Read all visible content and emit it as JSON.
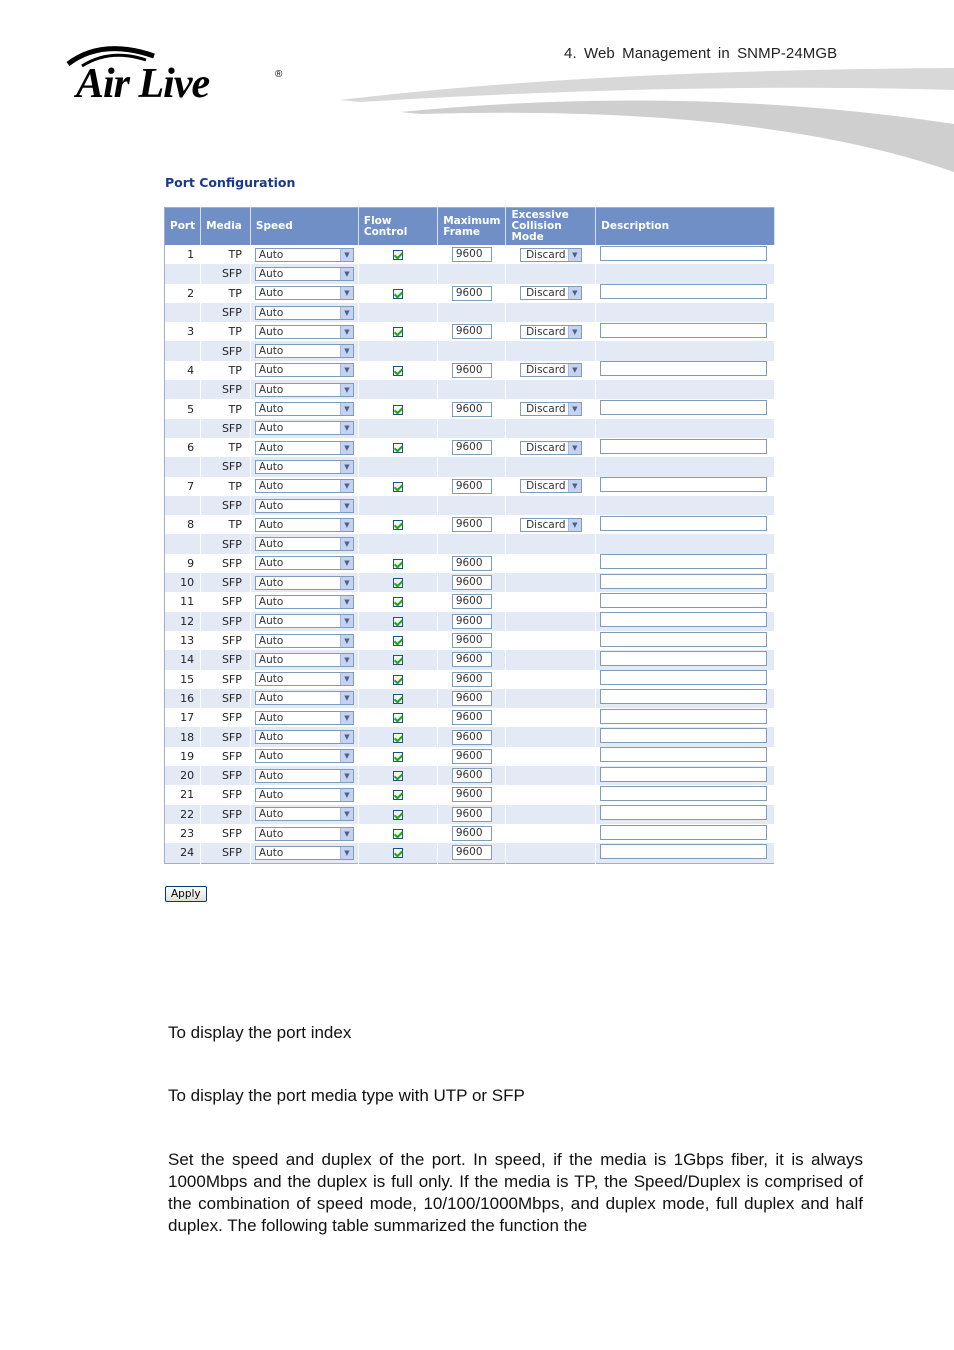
{
  "header": {
    "chapter_note": "4.  Web Management in SNMP-24MGB",
    "logo_text": "Air Live",
    "logo_mark": "®"
  },
  "panel": {
    "title": "Port Configuration",
    "columns": [
      "Port",
      "Media",
      "Speed",
      "Flow Control",
      "Maximum Frame",
      "Excessive Collision Mode",
      "Description"
    ],
    "apply_label": "Apply",
    "rows": [
      {
        "port": "1",
        "media": "TP",
        "speed": "Auto",
        "flow_control": true,
        "max_frame": "9600",
        "ecm": "Discard",
        "description": ""
      },
      {
        "port": "",
        "media": "SFP",
        "speed": "Auto",
        "flow_control": null,
        "max_frame": null,
        "ecm": null,
        "description": null
      },
      {
        "port": "2",
        "media": "TP",
        "speed": "Auto",
        "flow_control": true,
        "max_frame": "9600",
        "ecm": "Discard",
        "description": ""
      },
      {
        "port": "",
        "media": "SFP",
        "speed": "Auto",
        "flow_control": null,
        "max_frame": null,
        "ecm": null,
        "description": null
      },
      {
        "port": "3",
        "media": "TP",
        "speed": "Auto",
        "flow_control": true,
        "max_frame": "9600",
        "ecm": "Discard",
        "description": ""
      },
      {
        "port": "",
        "media": "SFP",
        "speed": "Auto",
        "flow_control": null,
        "max_frame": null,
        "ecm": null,
        "description": null
      },
      {
        "port": "4",
        "media": "TP",
        "speed": "Auto",
        "flow_control": true,
        "max_frame": "9600",
        "ecm": "Discard",
        "description": ""
      },
      {
        "port": "",
        "media": "SFP",
        "speed": "Auto",
        "flow_control": null,
        "max_frame": null,
        "ecm": null,
        "description": null
      },
      {
        "port": "5",
        "media": "TP",
        "speed": "Auto",
        "flow_control": true,
        "max_frame": "9600",
        "ecm": "Discard",
        "description": ""
      },
      {
        "port": "",
        "media": "SFP",
        "speed": "Auto",
        "flow_control": null,
        "max_frame": null,
        "ecm": null,
        "description": null
      },
      {
        "port": "6",
        "media": "TP",
        "speed": "Auto",
        "flow_control": true,
        "max_frame": "9600",
        "ecm": "Discard",
        "description": ""
      },
      {
        "port": "",
        "media": "SFP",
        "speed": "Auto",
        "flow_control": null,
        "max_frame": null,
        "ecm": null,
        "description": null
      },
      {
        "port": "7",
        "media": "TP",
        "speed": "Auto",
        "flow_control": true,
        "max_frame": "9600",
        "ecm": "Discard",
        "description": ""
      },
      {
        "port": "",
        "media": "SFP",
        "speed": "Auto",
        "flow_control": null,
        "max_frame": null,
        "ecm": null,
        "description": null
      },
      {
        "port": "8",
        "media": "TP",
        "speed": "Auto",
        "flow_control": true,
        "max_frame": "9600",
        "ecm": "Discard",
        "description": ""
      },
      {
        "port": "",
        "media": "SFP",
        "speed": "Auto",
        "flow_control": null,
        "max_frame": null,
        "ecm": null,
        "description": null
      },
      {
        "port": "9",
        "media": "SFP",
        "speed": "Auto",
        "flow_control": true,
        "max_frame": "9600",
        "ecm": null,
        "description": ""
      },
      {
        "port": "10",
        "media": "SFP",
        "speed": "Auto",
        "flow_control": true,
        "max_frame": "9600",
        "ecm": null,
        "description": ""
      },
      {
        "port": "11",
        "media": "SFP",
        "speed": "Auto",
        "flow_control": true,
        "max_frame": "9600",
        "ecm": null,
        "description": ""
      },
      {
        "port": "12",
        "media": "SFP",
        "speed": "Auto",
        "flow_control": true,
        "max_frame": "9600",
        "ecm": null,
        "description": ""
      },
      {
        "port": "13",
        "media": "SFP",
        "speed": "Auto",
        "flow_control": true,
        "max_frame": "9600",
        "ecm": null,
        "description": ""
      },
      {
        "port": "14",
        "media": "SFP",
        "speed": "Auto",
        "flow_control": true,
        "max_frame": "9600",
        "ecm": null,
        "description": ""
      },
      {
        "port": "15",
        "media": "SFP",
        "speed": "Auto",
        "flow_control": true,
        "max_frame": "9600",
        "ecm": null,
        "description": ""
      },
      {
        "port": "16",
        "media": "SFP",
        "speed": "Auto",
        "flow_control": true,
        "max_frame": "9600",
        "ecm": null,
        "description": ""
      },
      {
        "port": "17",
        "media": "SFP",
        "speed": "Auto",
        "flow_control": true,
        "max_frame": "9600",
        "ecm": null,
        "description": ""
      },
      {
        "port": "18",
        "media": "SFP",
        "speed": "Auto",
        "flow_control": true,
        "max_frame": "9600",
        "ecm": null,
        "description": ""
      },
      {
        "port": "19",
        "media": "SFP",
        "speed": "Auto",
        "flow_control": true,
        "max_frame": "9600",
        "ecm": null,
        "description": ""
      },
      {
        "port": "20",
        "media": "SFP",
        "speed": "Auto",
        "flow_control": true,
        "max_frame": "9600",
        "ecm": null,
        "description": ""
      },
      {
        "port": "21",
        "media": "SFP",
        "speed": "Auto",
        "flow_control": true,
        "max_frame": "9600",
        "ecm": null,
        "description": ""
      },
      {
        "port": "22",
        "media": "SFP",
        "speed": "Auto",
        "flow_control": true,
        "max_frame": "9600",
        "ecm": null,
        "description": ""
      },
      {
        "port": "23",
        "media": "SFP",
        "speed": "Auto",
        "flow_control": true,
        "max_frame": "9600",
        "ecm": null,
        "description": ""
      },
      {
        "port": "24",
        "media": "SFP",
        "speed": "Auto",
        "flow_control": true,
        "max_frame": "9600",
        "ecm": null,
        "description": ""
      }
    ]
  },
  "body_text": {
    "port_desc": "To display the port index",
    "media_desc": "To display the port media type with UTP or SFP",
    "speed_desc": "Set the speed and duplex of the port. In speed, if the media is 1Gbps fiber, it is always 1000Mbps and the duplex is full only. If the media is TP, the Speed/Duplex is comprised of the combination of speed mode, 10/100/1000Mbps, and duplex mode, full duplex and half duplex. The following table summarized the function the"
  },
  "colors": {
    "header_bg": "#6f8fc6",
    "row_alt_bg": "#e3eaf6",
    "title_color": "#1a3a8f"
  }
}
